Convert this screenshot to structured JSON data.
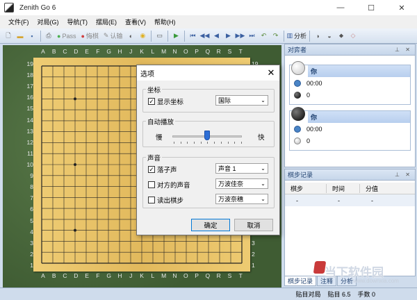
{
  "window": {
    "title": "Zenith Go 6",
    "min": "—",
    "max": "☐",
    "close": "✕"
  },
  "menu": [
    "文件(F)",
    "对局(G)",
    "导航(T)",
    "摆局(E)",
    "查看(V)",
    "帮助(H)"
  ],
  "toolbar": {
    "pass": "Pass",
    "resign": "悔棋",
    "confirm": "认输",
    "analyze": "分析"
  },
  "board": {
    "size": 19,
    "col_labels": [
      "A",
      "B",
      "C",
      "D",
      "E",
      "F",
      "G",
      "H",
      "J",
      "K",
      "L",
      "M",
      "N",
      "O",
      "P",
      "Q",
      "R",
      "S",
      "T"
    ],
    "row_labels": [
      "19",
      "18",
      "17",
      "16",
      "15",
      "14",
      "13",
      "12",
      "11",
      "10",
      "9",
      "8",
      "7",
      "6",
      "5",
      "4",
      "3",
      "2",
      "1"
    ]
  },
  "players_panel": {
    "title": "对弈者",
    "white": {
      "name": "你",
      "time": "00:00",
      "captures": "0"
    },
    "black": {
      "name": "你",
      "time": "00:00",
      "captures": "0"
    }
  },
  "moves_panel": {
    "title": "棋步记录",
    "columns": [
      "棋步",
      "时间",
      "分值"
    ],
    "rows": [
      [
        "-",
        "-",
        "-"
      ]
    ]
  },
  "tabs": [
    "棋步记录",
    "注释",
    "分析"
  ],
  "status": {
    "mode": "贴目对局",
    "komi": "贴目 6.5",
    "moves": "手数 0"
  },
  "dialog": {
    "title": "选项",
    "coords_group": "坐标",
    "show_coords": {
      "label": "显示坐标",
      "checked": true,
      "value": "国际"
    },
    "autoplay_group": "自动播放",
    "slow": "慢",
    "fast": "快",
    "speed_level": 0.5,
    "sound_group": "声音",
    "stone_sound": {
      "label": "落子声",
      "checked": true,
      "value": "声音 1"
    },
    "opponent_sound": {
      "label": "对方的声音",
      "checked": false,
      "value": "万波佳奈"
    },
    "read_moves": {
      "label": "读出棋步",
      "checked": false,
      "value": "万波奈穗"
    },
    "ok": "确定",
    "cancel": "取消"
  },
  "watermark": {
    "brand": "当下软件园",
    "url": "www.downxia.com"
  }
}
